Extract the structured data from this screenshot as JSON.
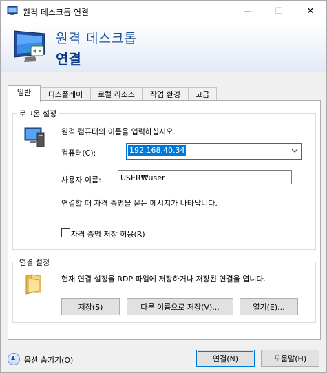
{
  "window": {
    "title": "원격 데스크톱 연결",
    "controls": {
      "minimize": "—",
      "maximize": "☐",
      "close": "✕"
    }
  },
  "banner": {
    "line1": "원격 데스크톱",
    "line2": "연결"
  },
  "tabs": [
    "일반",
    "디스플레이",
    "로컬 리소스",
    "작업 환경",
    "고급"
  ],
  "login_group": {
    "title": "로그온 설정",
    "instruction": "원격 컴퓨터의 이름을 입력하십시오.",
    "computer_label": "컴퓨터(C):",
    "computer_value": "192.168.40.34",
    "username_label": "사용자 이름:",
    "username_value": "USER₩user",
    "note": "연결할 때 자격 증명을 묻는 메시지가 나타납니다.",
    "save_credentials_label": "자격 증명 저장 허용(R)"
  },
  "connection_group": {
    "title": "연결 설정",
    "description": "현재 연결 설정을 RDP 파일에 저장하거나 저장된 연결을 엽니다.",
    "save_label": "저장(S)",
    "save_as_label": "다른 이름으로 저장(V)...",
    "open_label": "열기(E)..."
  },
  "footer": {
    "hide_options_label": "옵션 숨기기(O)",
    "connect_label": "연결(N)",
    "help_label": "도움말(H)"
  },
  "colors": {
    "accent": "#0078d7",
    "banner_title": "#1a4f9c",
    "banner_title_bold": "#0d3a86"
  },
  "icons": [
    "remote-desktop-icon",
    "monitor-icon",
    "folder-icon",
    "chevron-up-icon"
  ]
}
